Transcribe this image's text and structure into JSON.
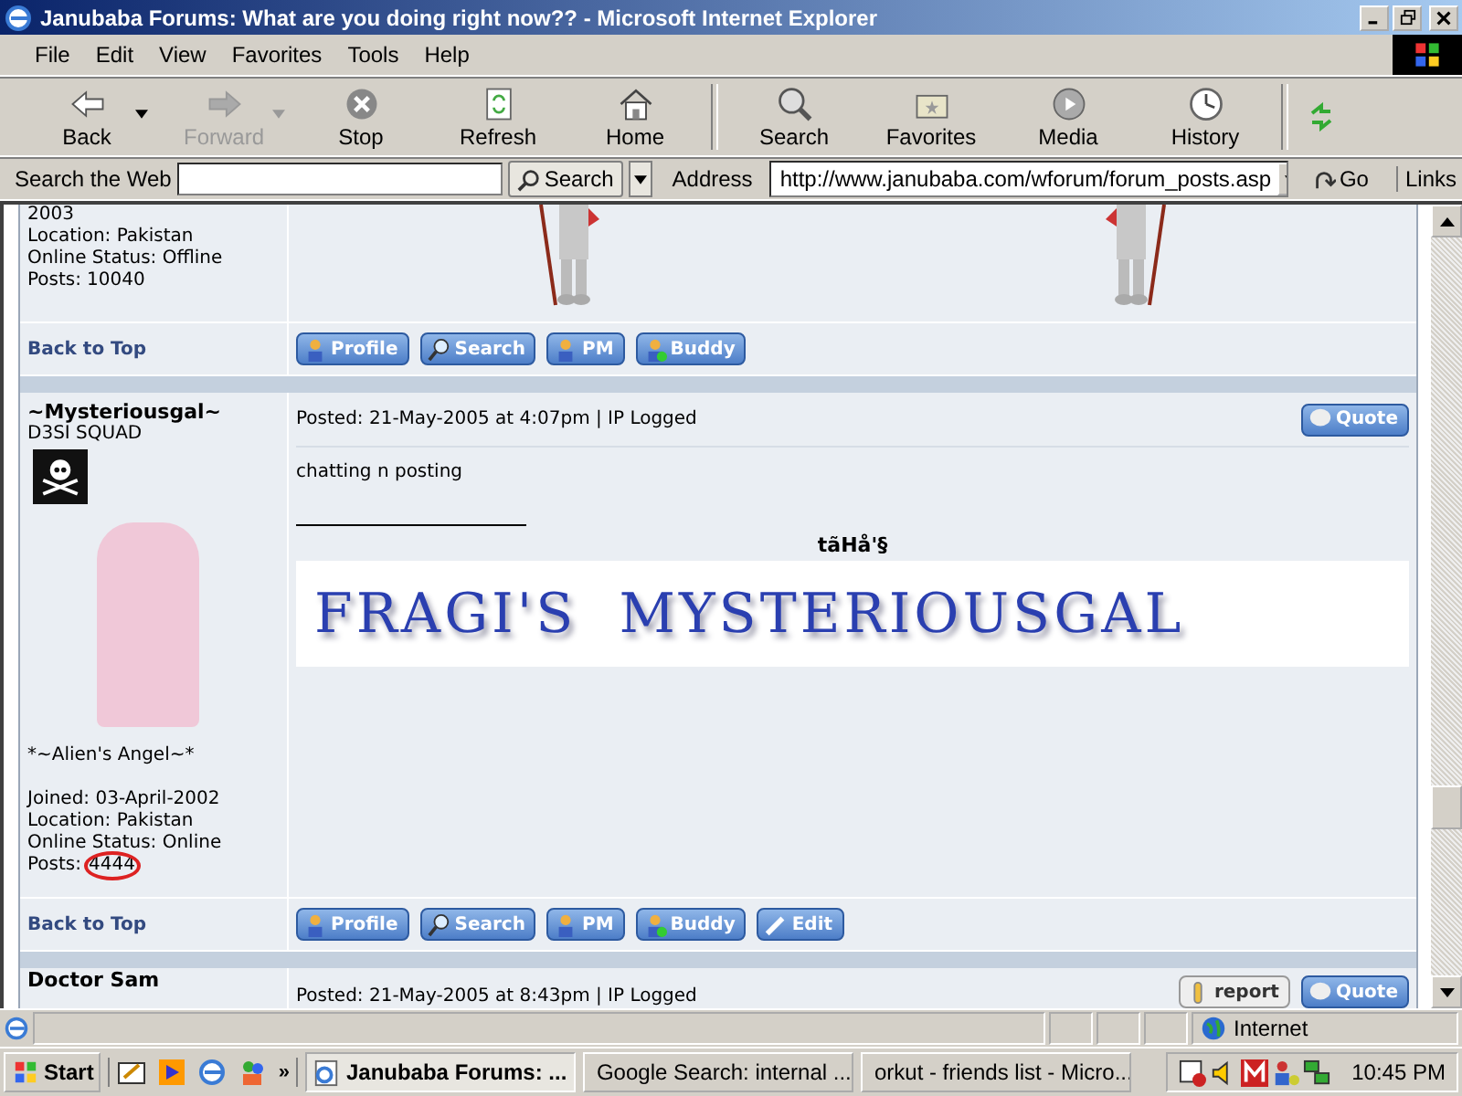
{
  "window": {
    "title": "Janubaba Forums: What are you doing right now?? - Microsoft Internet Explorer"
  },
  "menu": [
    "File",
    "Edit",
    "View",
    "Favorites",
    "Tools",
    "Help"
  ],
  "toolbar": [
    {
      "label": "Back",
      "kind": "back",
      "disabled": false,
      "dropdown": true
    },
    {
      "label": "Forward",
      "kind": "forward",
      "disabled": true,
      "dropdown": true
    },
    {
      "label": "Stop",
      "kind": "stop",
      "disabled": false,
      "dropdown": false
    },
    {
      "label": "Refresh",
      "kind": "refresh",
      "disabled": false,
      "dropdown": false
    },
    {
      "label": "Home",
      "kind": "home",
      "disabled": false,
      "dropdown": false
    },
    {
      "label": "Search",
      "kind": "search",
      "disabled": false,
      "dropdown": false
    },
    {
      "label": "Favorites",
      "kind": "favorites",
      "disabled": false,
      "dropdown": false
    },
    {
      "label": "Media",
      "kind": "media",
      "disabled": false,
      "dropdown": false
    },
    {
      "label": "History",
      "kind": "history",
      "disabled": false,
      "dropdown": false
    }
  ],
  "search_bar": {
    "label": "Search the Web",
    "button": "Search"
  },
  "address_bar": {
    "label": "Address",
    "url": "http://www.janubaba.com/wforum/forum_posts.asp",
    "go": "Go",
    "links": "Links"
  },
  "posts": [
    {
      "info": [
        "2003",
        "Location: Pakistan",
        "Online Status: Offline"
      ],
      "posts": {
        "label": "Posts:",
        "count": "10040",
        "circled": false
      },
      "back_to_top": "Back to Top",
      "buttons": [
        {
          "label": "Profile",
          "kind": "profile"
        },
        {
          "label": "Search",
          "kind": "search"
        },
        {
          "label": "PM",
          "kind": "pm"
        },
        {
          "label": "Buddy",
          "kind": "buddy"
        }
      ]
    },
    {
      "author": "~Mysteriousgal~",
      "rank": "D3SI SQUAD",
      "posted": "Posted: 21-May-2005 at 4:07pm | IP Logged",
      "actions": [
        {
          "label": "Quote",
          "kind": "quote"
        }
      ],
      "body": "chatting n posting",
      "signature_name": "tãHå'§",
      "signature_banner": "FRAGI'S  MYSTERIOUSGAL",
      "member_title": "*~Alien's Angel~*",
      "info": [
        "Joined: 03-April-2002",
        "Location: Pakistan",
        "Online Status: Online"
      ],
      "posts": {
        "label": "Posts:",
        "count": "4444",
        "circled": true
      },
      "back_to_top": "Back to Top",
      "buttons": [
        {
          "label": "Profile",
          "kind": "profile"
        },
        {
          "label": "Search",
          "kind": "search"
        },
        {
          "label": "PM",
          "kind": "pm"
        },
        {
          "label": "Buddy",
          "kind": "buddy"
        },
        {
          "label": "Edit",
          "kind": "edit"
        }
      ]
    },
    {
      "author": "Doctor Sam",
      "posted": "Posted: 21-May-2005 at 8:43pm | IP Logged",
      "actions": [
        {
          "label": "report",
          "kind": "report"
        },
        {
          "label": "Quote",
          "kind": "quote"
        }
      ]
    }
  ],
  "status_bar": {
    "zone": "Internet"
  },
  "taskbar": {
    "start": "Start",
    "more": "»",
    "tasks": [
      {
        "label": "Janubaba Forums: ...",
        "selected": true
      },
      {
        "label": "Google Search: internal ...",
        "selected": false
      },
      {
        "label": "orkut - friends list - Micro...",
        "selected": false
      }
    ],
    "clock": "10:45 PM"
  }
}
